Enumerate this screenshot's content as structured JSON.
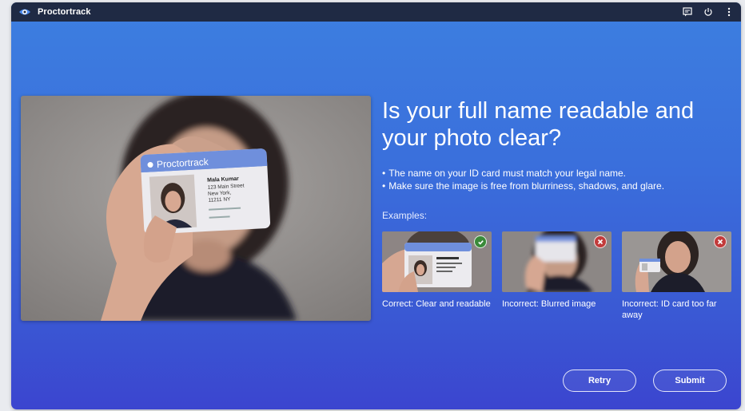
{
  "window": {
    "app_title": "Proctortrack"
  },
  "titlebar_icons": [
    "chat-icon",
    "power-icon",
    "more-vertical-icon"
  ],
  "main": {
    "heading": "Is your full name readable and your photo clear?",
    "bullets": [
      "The name on your ID card must match your legal name.",
      "Make sure the image is free from blurriness, shadows, and glare."
    ],
    "examples_label": "Examples:",
    "examples": [
      {
        "caption": "Correct: Clear and readable",
        "status": "correct"
      },
      {
        "caption": "Incorrect: Blurred image",
        "status": "incorrect"
      },
      {
        "caption": "Incorrect: ID card too far away",
        "status": "incorrect"
      }
    ]
  },
  "id_card": {
    "brand": "Proctortrack",
    "name": "Mala Kumar",
    "address_line1": "123 Main Street",
    "address_line2": "New York,",
    "address_line3": "11211 NY"
  },
  "buttons": {
    "retry": "Retry",
    "submit": "Submit"
  },
  "colors": {
    "titlebar": "#1f2a44",
    "background_top": "#3d7fe0",
    "background_bottom": "#3b45cf",
    "correct": "#3a8a3a",
    "incorrect": "#c23b3b"
  }
}
